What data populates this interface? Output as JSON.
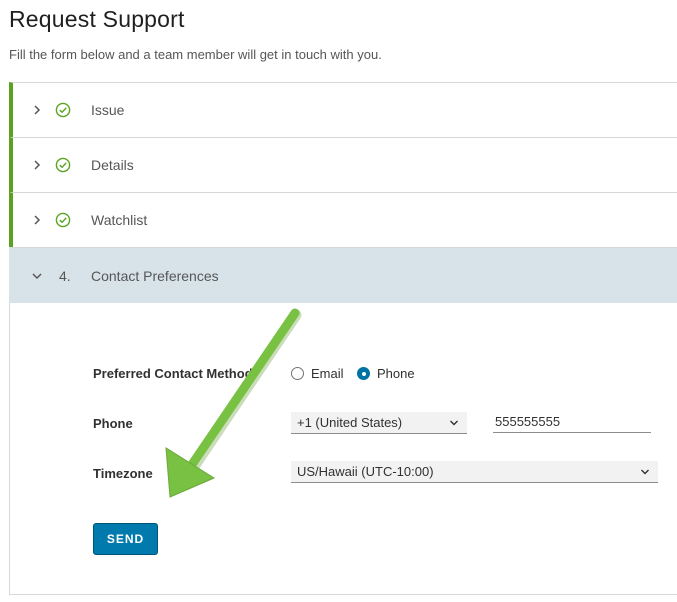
{
  "page": {
    "title": "Request Support",
    "subtitle": "Fill the form below and a team member will get in touch with you."
  },
  "steps": [
    {
      "label": "Issue",
      "status": "complete",
      "icon": "check-circle-icon"
    },
    {
      "label": "Details",
      "status": "complete",
      "icon": "check-circle-icon"
    },
    {
      "label": "Watchlist",
      "status": "complete",
      "icon": "check-circle-icon"
    },
    {
      "number": "4.",
      "label": "Contact Preferences",
      "status": "active"
    }
  ],
  "form": {
    "contact_method": {
      "label": "Preferred Contact Method",
      "options": [
        "Email",
        "Phone"
      ],
      "selected": "Phone"
    },
    "phone": {
      "label": "Phone",
      "country_code": "+1 (United States)",
      "number": "555555555"
    },
    "timezone": {
      "label": "Timezone",
      "value": "US/Hawaii (UTC-10:00)"
    },
    "send_label": "SEND"
  },
  "colors": {
    "accent": "#0079ad",
    "complete": "#5aa220",
    "active_step_bg": "#d8e3e9",
    "annotation_arrow": "#79c142"
  }
}
